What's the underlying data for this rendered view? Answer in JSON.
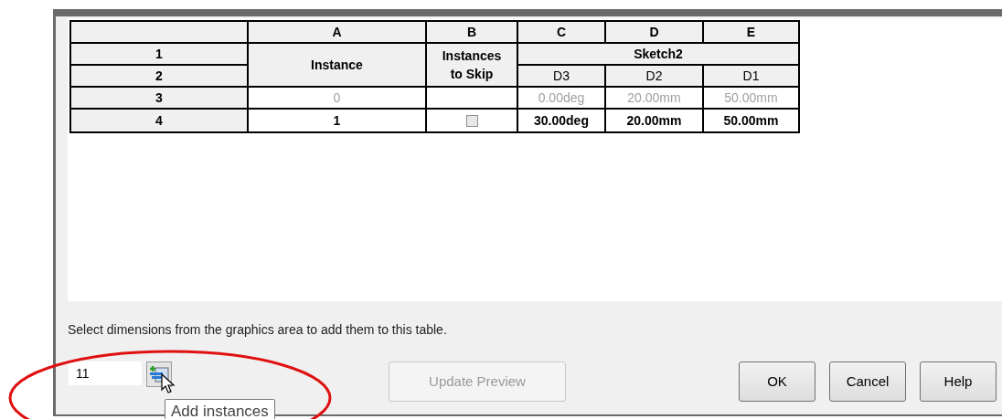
{
  "table": {
    "column_letters": [
      "A",
      "B",
      "C",
      "D",
      "E"
    ],
    "row_numbers": [
      "1",
      "2",
      "3",
      "4"
    ],
    "instance_header": "Instance",
    "skip_header": "Instances to Skip",
    "group_header": "Sketch2",
    "dimension_headers": [
      "D3",
      "D2",
      "D1"
    ],
    "rows": [
      {
        "instance": "0",
        "disabled": true,
        "values": [
          "0.00deg",
          "20.00mm",
          "50.00mm"
        ]
      },
      {
        "instance": "1",
        "disabled": false,
        "skip": {
          "checked": false
        },
        "values": [
          "30.00deg",
          "20.00mm",
          "50.00mm"
        ]
      }
    ]
  },
  "hint": "Select dimensions from the graphics area to add them to this table.",
  "instance_count": {
    "value": "11"
  },
  "tooltip": "Add instances",
  "update_button": {
    "label": "Update Preview",
    "disabled": true
  },
  "buttons": [
    "OK",
    "Cancel",
    "Help"
  ]
}
